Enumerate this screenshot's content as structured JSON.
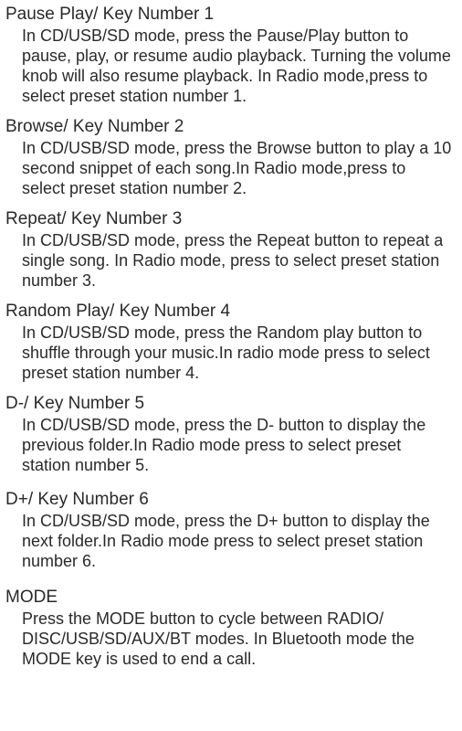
{
  "sections": [
    {
      "title": "Pause Play/ Key Number 1",
      "body": "In CD/USB/SD mode, press the Pause/Play button to pause, play, or resume audio playback. Turning the volume knob will also resume playback. In Radio mode,press to select preset station number 1."
    },
    {
      "title": "Browse/ Key Number 2",
      "body": "In CD/USB/SD mode, press the Browse button to play a 10 second snippet of each song.In Radio mode,press to select preset station number 2."
    },
    {
      "title": "Repeat/ Key Number 3",
      "body": "In CD/USB/SD mode, press the Repeat  button to repeat a single song. In Radio mode, press to select preset station number 3."
    },
    {
      "title": "Random Play/ Key Number 4",
      "body": "In CD/USB/SD mode, press the Random play  button to shuffle through your music.In radio mode press to select preset station number 4."
    },
    {
      "title": "D-/ Key Number 5",
      "body": "In CD/USB/SD mode, press the D- button to display the previous folder.In Radio mode press to select preset station number 5."
    },
    {
      "title": "D+/ Key Number 6",
      "body": "In CD/USB/SD mode, press the D+ button to display the next folder.In Radio mode press to select preset station number 6."
    },
    {
      "title": "MODE",
      "body": "Press the MODE button to cycle between RADIO/ DISC/USB/SD/AUX/BT modes. In Bluetooth mode the MODE key is used to end a call."
    }
  ]
}
